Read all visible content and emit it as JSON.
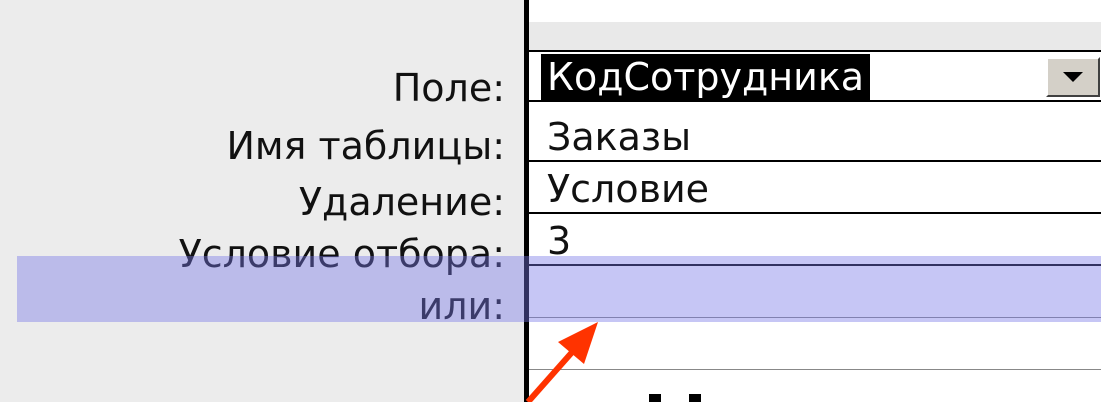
{
  "labels": {
    "field": "Поле:",
    "table_name": "Имя таблицы:",
    "delete": "Удаление:",
    "criteria": "Условие отбора:",
    "or": "или:"
  },
  "values": {
    "field": "КодСотрудника",
    "table_name": "Заказы",
    "delete": "Условие",
    "criteria": "3",
    "or": ""
  },
  "icons": {
    "dropdown": "dropdown-arrow-icon",
    "annotation_arrow": "red-arrow-icon"
  },
  "colors": {
    "highlight": "#7878e6",
    "arrow": "#ff3300",
    "selection": "#000000"
  }
}
